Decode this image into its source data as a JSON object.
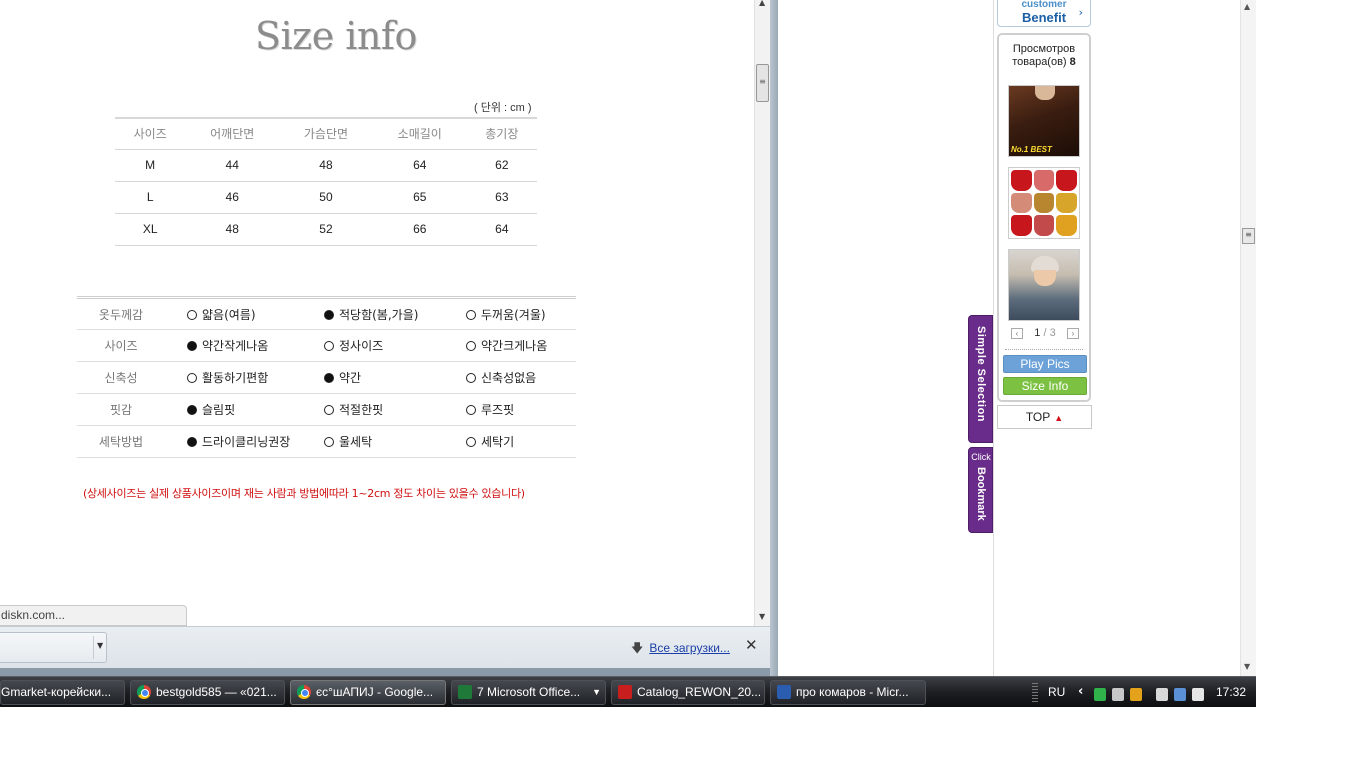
{
  "popup": {
    "size_title": "Size info",
    "unit_note": "( 단위 : cm )",
    "size_table": {
      "headers": [
        "사이즈",
        "어깨단면",
        "가슴단면",
        "소매길이",
        "총기장"
      ],
      "rows": [
        [
          "M",
          "44",
          "48",
          "64",
          "62"
        ],
        [
          "L",
          "46",
          "50",
          "65",
          "63"
        ],
        [
          "XL",
          "48",
          "52",
          "66",
          "64"
        ]
      ]
    },
    "feel_table": [
      {
        "label": "옷두께감",
        "options": [
          {
            "text": "얇음(여름)",
            "selected": false
          },
          {
            "text": "적당함(봄,가을)",
            "selected": true
          },
          {
            "text": "두꺼움(겨울)",
            "selected": false
          }
        ]
      },
      {
        "label": "사이즈",
        "options": [
          {
            "text": "약간작게나옴",
            "selected": true
          },
          {
            "text": "정사이즈",
            "selected": false
          },
          {
            "text": "약간크게나옴",
            "selected": false
          }
        ]
      },
      {
        "label": "신축성",
        "options": [
          {
            "text": "활동하기편함",
            "selected": false
          },
          {
            "text": "약간",
            "selected": true
          },
          {
            "text": "신축성없음",
            "selected": false
          }
        ]
      },
      {
        "label": "핏감",
        "options": [
          {
            "text": "슬림핏",
            "selected": true
          },
          {
            "text": "적절한핏",
            "selected": false
          },
          {
            "text": "루즈핏",
            "selected": false
          }
        ]
      },
      {
        "label": "세탁방법",
        "options": [
          {
            "text": "드라이클리닝권장",
            "selected": true
          },
          {
            "text": "울세탁",
            "selected": false
          },
          {
            "text": "세탁기",
            "selected": false
          }
        ]
      }
    ],
    "notice": "(상세사이즈는 실제 상품사이즈이며 재는 사람과 방법에따라 1~2cm 정도 차이는 있을수 있습니다)",
    "status_url": "diskn.com...",
    "download_all": "Все загрузки...",
    "close_glyph": "✕"
  },
  "sidebar": {
    "benefit_line1": "customer",
    "benefit_line2": "Benefit",
    "viewed_title": "Просмотров товара(ов)",
    "viewed_count": "8",
    "item1_badge": "No.1 BEST",
    "pager_current": "1",
    "pager_total": "3",
    "play_pics": "Play Pics",
    "size_info": "Size Info",
    "top": "TOP",
    "tab_simple": "Simple Selection",
    "tab_click": "Click",
    "tab_bookmark": "Bookmark"
  },
  "taskbar": {
    "buttons": [
      {
        "label": "Gmarket-корейски...",
        "icon": "none"
      },
      {
        "label": "bestgold585 — «021...",
        "icon": "chrome-icon"
      },
      {
        "label": "єс°шАПИЈ - Google...",
        "icon": "chrome-icon"
      },
      {
        "label": "7 Microsoft Office...",
        "icon": "excel-icon"
      },
      {
        "label": "Catalog_REWON_20...",
        "icon": "pdf-icon"
      },
      {
        "label": "про комаров - Micr...",
        "icon": "word-icon"
      }
    ],
    "lang": "RU",
    "clock": "17:32"
  },
  "colors": {
    "notice_red": "#d01010",
    "play_blue": "#6da2d8",
    "size_green": "#7cc142",
    "tab_purple": "#6a2c8a"
  }
}
